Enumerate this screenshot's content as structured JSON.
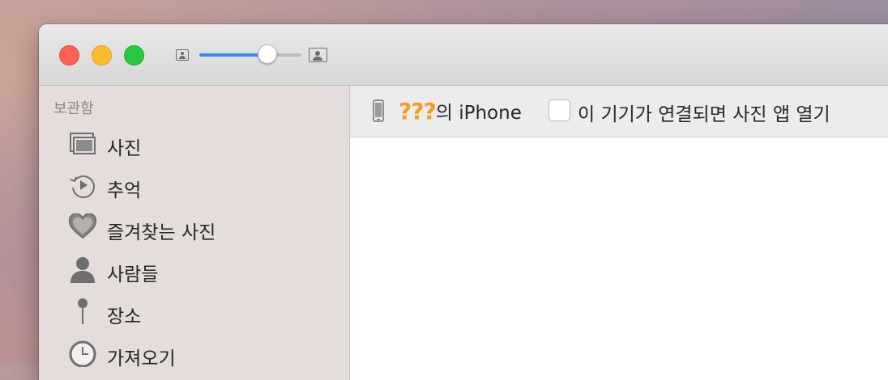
{
  "window": {
    "controls": [
      "close",
      "minimize",
      "zoom"
    ],
    "thumbnail_size": {
      "min_icon": "small-photo-icon",
      "max_icon": "large-photo-icon",
      "value": 0.67,
      "accent": "#3b87f3"
    }
  },
  "sidebar": {
    "section_title": "보관함",
    "items": [
      {
        "label": "사진",
        "icon": "photos-icon"
      },
      {
        "label": "추억",
        "icon": "memories-icon"
      },
      {
        "label": "즐겨찾는 사진",
        "icon": "heart-icon"
      },
      {
        "label": "사람들",
        "icon": "person-icon"
      },
      {
        "label": "장소",
        "icon": "pin-icon"
      },
      {
        "label": "가져오기",
        "icon": "clock-icon"
      }
    ]
  },
  "device_bar": {
    "device_icon": "iphone-icon",
    "owner": "???",
    "suffix": "의 iPhone",
    "open_checkbox": {
      "checked": false,
      "label": "이 기기가 연결되면 사진 앱 열기"
    }
  }
}
